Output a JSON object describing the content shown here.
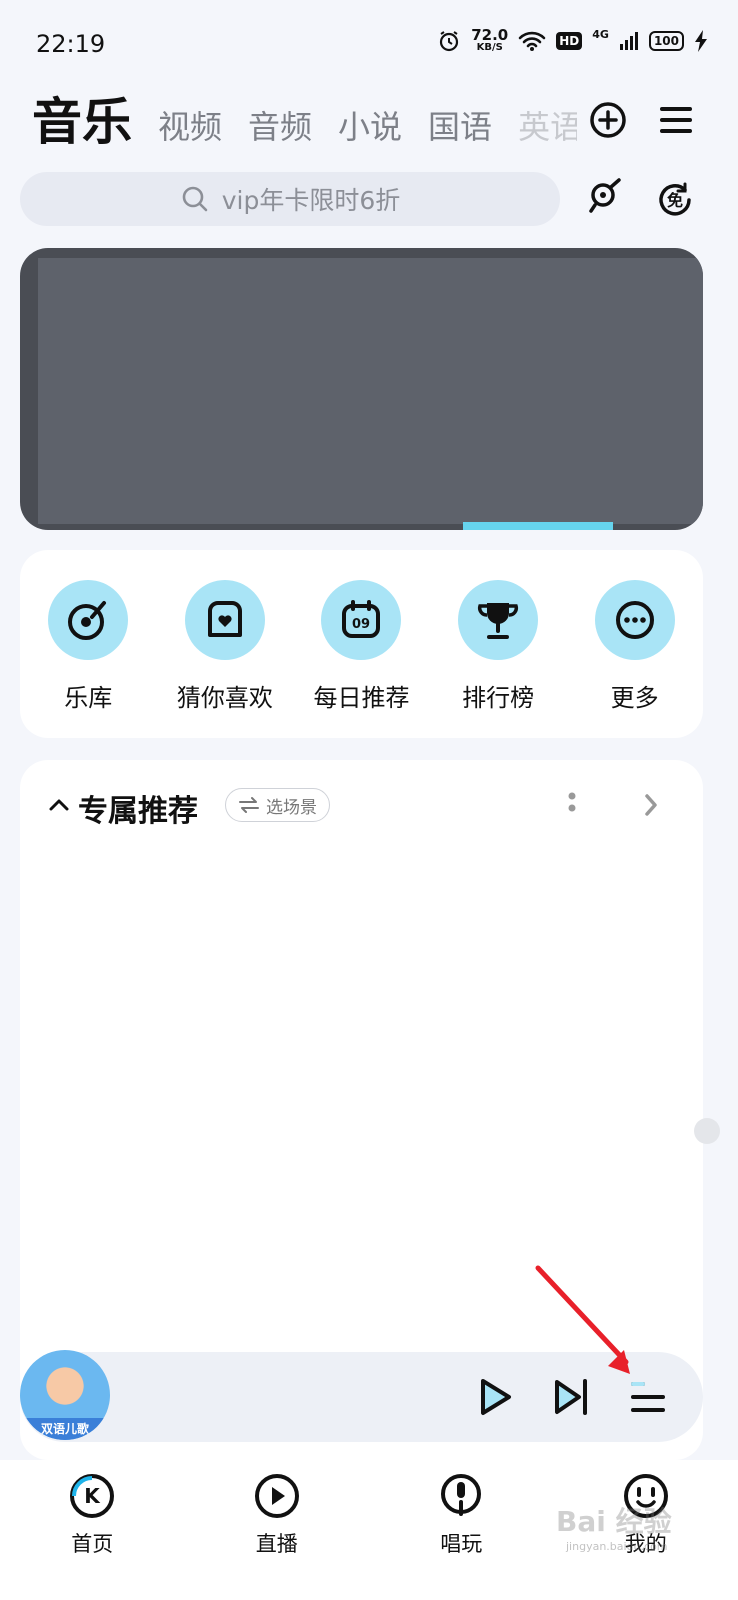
{
  "status_bar": {
    "time": "22:19",
    "speed_value": "72.0",
    "speed_unit": "KB/S",
    "hd": "HD",
    "network": "4G",
    "battery": "100"
  },
  "tabs": [
    {
      "label": "音乐",
      "active": true
    },
    {
      "label": "视频"
    },
    {
      "label": "音频"
    },
    {
      "label": "小说"
    },
    {
      "label": "国语"
    },
    {
      "label": "英语"
    }
  ],
  "search": {
    "placeholder": "vip年卡限时6折"
  },
  "quick_entries": [
    {
      "label": "乐库",
      "icon": "vinyl-icon"
    },
    {
      "label": "猜你喜欢",
      "icon": "heart-box-icon"
    },
    {
      "label": "每日推荐",
      "icon": "calendar-icon",
      "badge": "09"
    },
    {
      "label": "排行榜",
      "icon": "trophy-icon"
    },
    {
      "label": "更多",
      "icon": "more-icon"
    }
  ],
  "recommend": {
    "title": "专属推荐",
    "scene_button": "选场景"
  },
  "player": {
    "cover_caption": "双语儿歌"
  },
  "bottom_nav": [
    {
      "label": "首页",
      "icon": "home-k-icon"
    },
    {
      "label": "直播",
      "icon": "live-icon"
    },
    {
      "label": "唱玩",
      "icon": "mic-icon"
    },
    {
      "label": "我的",
      "icon": "profile-icon"
    }
  ],
  "watermark": {
    "main": "Bai 经验",
    "sub": "jingyan.baidu.com"
  },
  "colors": {
    "accent": "#1fb4ea",
    "icon_bg": "#a9e4f6",
    "annotation_arrow": "#e8202a"
  }
}
